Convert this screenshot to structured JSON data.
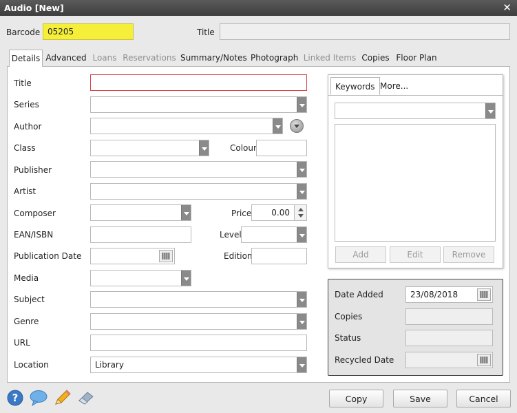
{
  "window": {
    "title": "Audio [New]",
    "close_icon": "close-icon"
  },
  "header": {
    "barcode_label": "Barcode",
    "barcode_value": "05205",
    "title_label": "Title",
    "title_value": ""
  },
  "tabs": [
    {
      "label": "Details",
      "active": true
    },
    {
      "label": "Advanced"
    },
    {
      "label": "Loans",
      "disabled": true
    },
    {
      "label": "Reservations",
      "disabled": true
    },
    {
      "label": "Summary/Notes"
    },
    {
      "label": "Photograph"
    },
    {
      "label": "Linked Items",
      "disabled": true
    },
    {
      "label": "Copies"
    },
    {
      "label": "Floor Plan"
    }
  ],
  "details": {
    "title_label": "Title",
    "series_label": "Series",
    "author_label": "Author",
    "class_label": "Class",
    "colour_label": "Colour",
    "publisher_label": "Publisher",
    "artist_label": "Artist",
    "composer_label": "Composer",
    "price_label": "Price",
    "price_value": "0.00",
    "ean_label": "EAN/ISBN",
    "level_label": "Level",
    "pubdate_label": "Publication Date",
    "edition_label": "Edition",
    "media_label": "Media",
    "subject_label": "Subject",
    "genre_label": "Genre",
    "url_label": "URL",
    "location_label": "Location",
    "location_value": "Library"
  },
  "keywords": {
    "tabs": [
      "Keywords",
      "More..."
    ],
    "add": "Add",
    "edit": "Edit",
    "remove": "Remove"
  },
  "dates": {
    "date_added_label": "Date Added",
    "date_added_value": "23/08/2018",
    "copies_label": "Copies",
    "status_label": "Status",
    "recycled_label": "Recycled Date"
  },
  "footer": {
    "copy": "Copy",
    "save": "Save",
    "cancel": "Cancel",
    "icons": [
      "help-icon",
      "comment-icon",
      "pencil-icon",
      "eraser-icon"
    ]
  },
  "colors": {
    "barcode_highlight": "#f5ef3a",
    "required_border": "#d84444"
  }
}
